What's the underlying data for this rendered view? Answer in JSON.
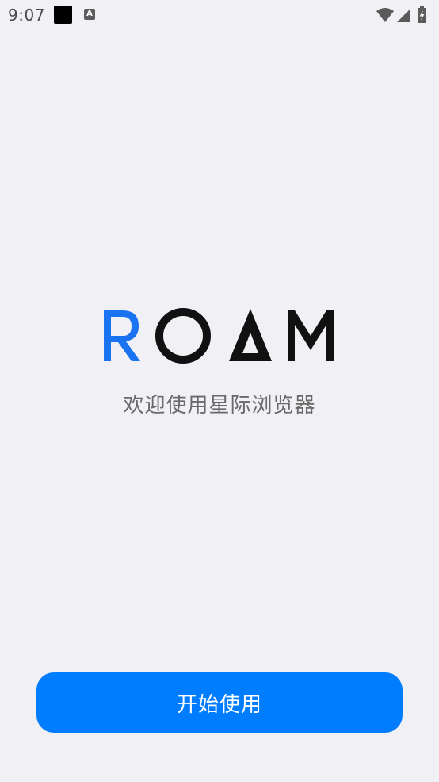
{
  "status_bar": {
    "time": "9:07",
    "notification_icons": [
      "black-square-icon",
      "a-badge-icon"
    ],
    "notif_a_letter": "A",
    "system_icons": [
      "wifi-icon",
      "signal-icon",
      "battery-charging-icon"
    ]
  },
  "logo": {
    "text": "ROAM",
    "letters": [
      "R",
      "O",
      "A",
      "M"
    ],
    "accent_color": "#1a73f0",
    "text_color": "#111111"
  },
  "welcome": {
    "subtitle": "欢迎使用星际浏览器"
  },
  "actions": {
    "start_label": "开始使用",
    "button_color": "#007dff"
  }
}
